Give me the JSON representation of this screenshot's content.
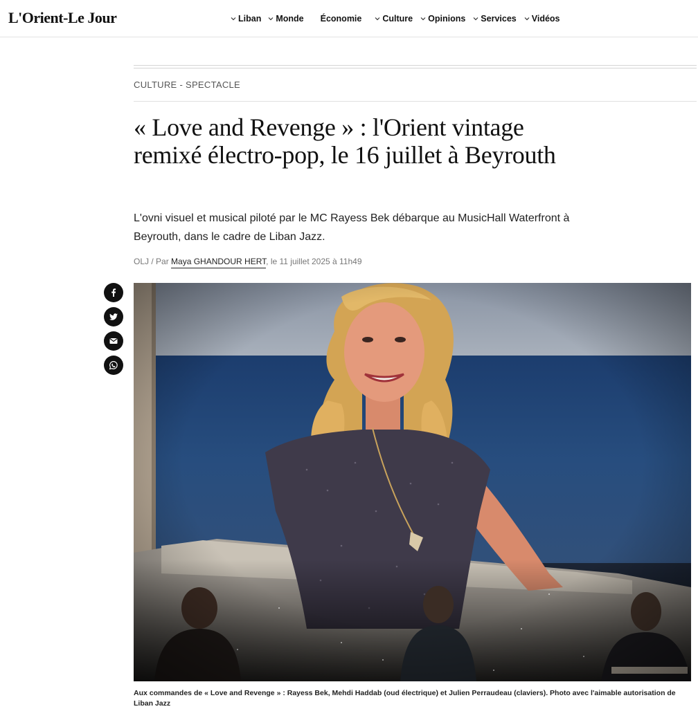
{
  "header": {
    "logo": "L'Orient-Le Jour",
    "nav": [
      {
        "label": "Liban",
        "dropdown": true
      },
      {
        "label": "Monde",
        "dropdown": true
      },
      {
        "label": "Économie",
        "dropdown": false
      },
      {
        "label": "Culture",
        "dropdown": true
      },
      {
        "label": "Opinions",
        "dropdown": true
      },
      {
        "label": "Services",
        "dropdown": true
      },
      {
        "label": "Vidéos",
        "dropdown": true
      }
    ]
  },
  "article": {
    "section": "CULTURE - SPECTACLE",
    "headline": "« Love and Revenge » : l'Orient vintage remixé électro-pop, le 16 juillet à Beyrouth",
    "lead": "L'ovni visuel et musical piloté par le MC Rayess Bek débarque au MusicHall Waterfront à Beyrouth, dans le cadre de Liban Jazz.",
    "byline": {
      "prefix": "OLJ / Par ",
      "author": "Maya GHANDOUR HERT",
      "date": ", le 11 juillet 2025 à 11h49"
    },
    "caption": "Aux commandes de « Love and Revenge » : Rayess Bek, Mehdi Haddab (oud électrique) et Julien Perraudeau (claviers). Photo avec l'aimable autorisation de Liban Jazz"
  },
  "share": [
    {
      "icon": "facebook-icon"
    },
    {
      "icon": "twitter-icon"
    },
    {
      "icon": "email-icon"
    },
    {
      "icon": "whatsapp-icon"
    }
  ],
  "colors": {
    "text": "#111111",
    "muted": "#777777",
    "share_bg": "#111111"
  }
}
